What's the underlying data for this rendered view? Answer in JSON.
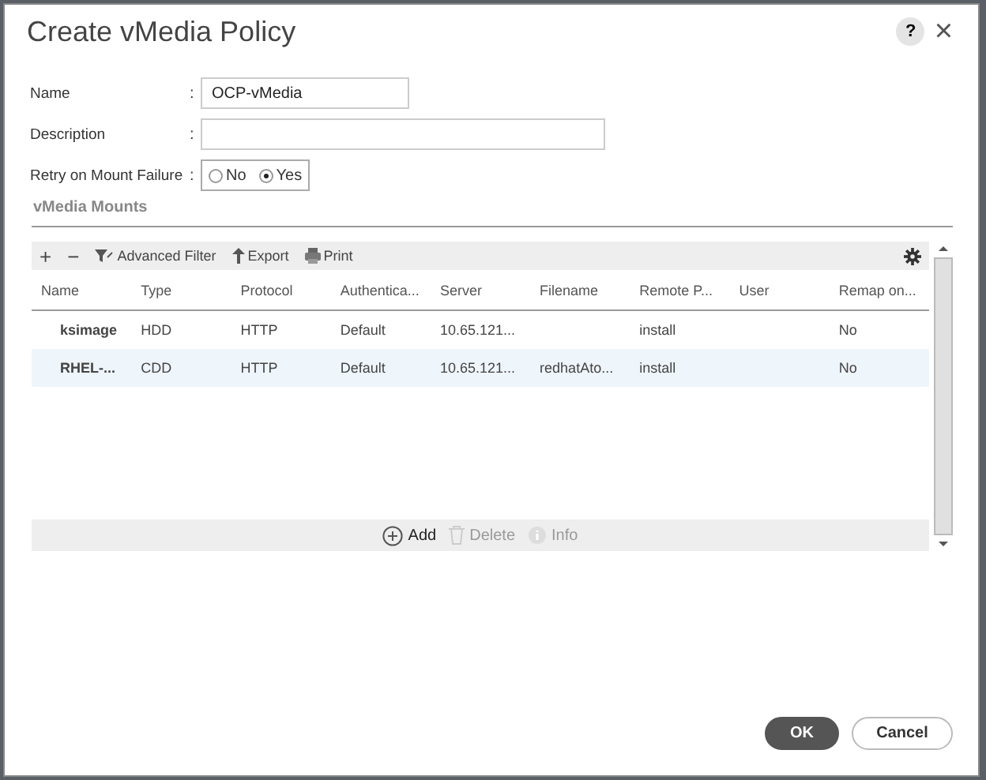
{
  "dialog": {
    "title": "Create vMedia Policy",
    "help_label": "?",
    "close_label": "×"
  },
  "form": [
    {
      "label": "Name",
      "colon": ":",
      "value": "OCP-vMedia",
      "kind": "text"
    },
    {
      "label": "Description",
      "colon": ":",
      "kind": "longtext"
    },
    {
      "label": "Retry on Mount Failure",
      "colon": ":",
      "kind": "radio",
      "options": [
        {
          "label": "No",
          "selected": false
        },
        {
          "label": "Yes",
          "selected": true
        }
      ]
    }
  ],
  "section_title": "vMedia Mounts",
  "toolbar": [
    {
      "label": "+",
      "kind": "glyph"
    },
    {
      "label": "−",
      "kind": "glyph"
    },
    {
      "label": "Advanced Filter",
      "kind": "filter"
    },
    {
      "label": "Export",
      "kind": "export"
    },
    {
      "label": "Print",
      "kind": "print"
    }
  ],
  "table": {
    "columns": [
      "Name",
      "Type",
      "Protocol",
      "Authentica...",
      "Server",
      "Filename",
      "Remote P...",
      "User",
      "Remap on..."
    ],
    "rows": [
      {
        "selected": false,
        "cells": [
          "ksimage",
          "HDD",
          "HTTP",
          "Default",
          "10.65.121...",
          "",
          "install",
          "",
          "No"
        ]
      },
      {
        "selected": true,
        "cells": [
          "RHEL-...",
          "CDD",
          "HTTP",
          "Default",
          "10.65.121...",
          "redhatAto...",
          "install",
          "",
          "No"
        ]
      }
    ]
  },
  "table_actions": [
    {
      "label": "Add",
      "kind": "add",
      "disabled": false
    },
    {
      "label": "Delete",
      "kind": "delete",
      "disabled": true
    },
    {
      "label": "Info",
      "kind": "info",
      "disabled": true
    }
  ],
  "buttons": [
    {
      "label": "OK",
      "kind": "primary"
    },
    {
      "label": "Cancel",
      "kind": "secondary"
    }
  ]
}
